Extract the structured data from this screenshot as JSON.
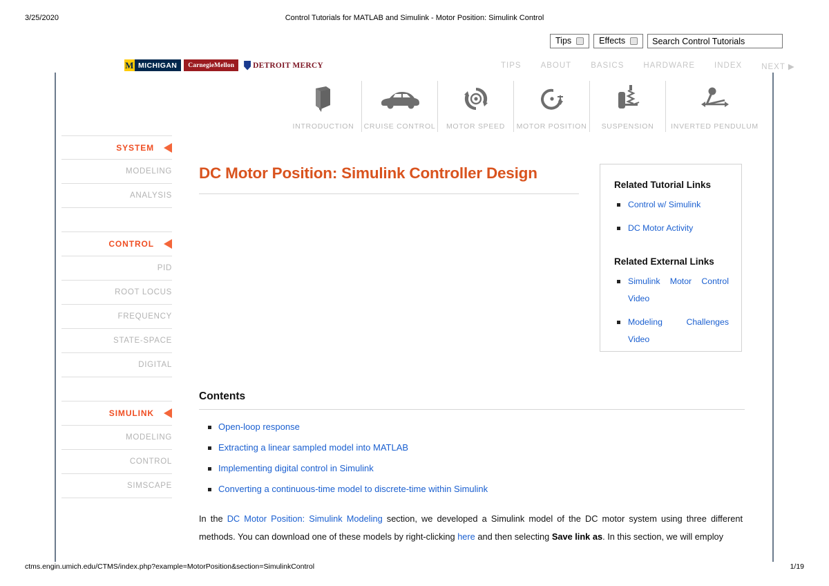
{
  "print_header": {
    "date": "3/25/2020",
    "title": "Control Tutorials for MATLAB and Simulink - Motor Position: Simulink Control"
  },
  "search": {
    "tips_label": "Tips",
    "effects_label": "Effects",
    "placeholder": "Search Control Tutorials",
    "value": "Search Control Tutorials"
  },
  "logos": [
    {
      "name": "university-of-michigan",
      "mark": "M",
      "text": "MICHIGAN"
    },
    {
      "name": "carnegie-mellon",
      "text": "CarnegieMellon"
    },
    {
      "name": "detroit-mercy",
      "text": "DETROIT MERCY"
    }
  ],
  "topnav": [
    {
      "label": "TIPS"
    },
    {
      "label": "ABOUT"
    },
    {
      "label": "BASICS"
    },
    {
      "label": "HARDWARE"
    },
    {
      "label": "INDEX"
    },
    {
      "label": "NEXT ▶"
    }
  ],
  "iconnav": [
    {
      "label": "INTRODUCTION",
      "icon": "book-icon"
    },
    {
      "label": "CRUISE CONTROL",
      "icon": "car-icon"
    },
    {
      "label": "MOTOR SPEED",
      "icon": "rotation-speed-icon"
    },
    {
      "label": "MOTOR POSITION",
      "icon": "rotation-position-icon"
    },
    {
      "label": "SUSPENSION",
      "icon": "suspension-strut-icon"
    },
    {
      "label": "INVERTED PENDULUM",
      "icon": "inverted-pendulum-icon"
    }
  ],
  "sidebar": {
    "items": [
      {
        "label": "SYSTEM",
        "type": "head"
      },
      {
        "label": "MODELING",
        "type": "sub"
      },
      {
        "label": "ANALYSIS",
        "type": "sub"
      },
      {
        "label": "",
        "type": "spacer"
      },
      {
        "label": "CONTROL",
        "type": "head"
      },
      {
        "label": "PID",
        "type": "sub"
      },
      {
        "label": "ROOT LOCUS",
        "type": "sub"
      },
      {
        "label": "FREQUENCY",
        "type": "sub"
      },
      {
        "label": "STATE-SPACE",
        "type": "sub"
      },
      {
        "label": "DIGITAL",
        "type": "sub"
      },
      {
        "label": "",
        "type": "spacer"
      },
      {
        "label": "SIMULINK",
        "type": "head"
      },
      {
        "label": "MODELING",
        "type": "sub"
      },
      {
        "label": "CONTROL",
        "type": "sub"
      },
      {
        "label": "SIMSCAPE",
        "type": "sub"
      }
    ]
  },
  "main": {
    "title": "DC Motor Position: Simulink Controller Design",
    "contents_heading": "Contents",
    "contents": [
      {
        "label": "Open-loop response"
      },
      {
        "label": "Extracting a linear sampled model into MATLAB"
      },
      {
        "label": "Implementing digital control in Simulink"
      },
      {
        "label": "Converting a continuous-time model to discrete-time within Simulink"
      }
    ],
    "paragraph": {
      "t1": "In the ",
      "link1": "DC Motor Position: Simulink Modeling",
      "t2": " section, we developed a Simulink model of the DC motor system using three different methods. You can download one of these models by right-clicking ",
      "link2": "here",
      "t3": " and then selecting ",
      "bold1": "Save link as",
      "t4": ". In this section, we will employ"
    }
  },
  "related": {
    "tutorial_heading": "Related Tutorial Links",
    "tutorial_links": [
      {
        "label": "Control w/ Simulink"
      },
      {
        "label": "DC Motor Activity"
      }
    ],
    "external_heading": "Related External Links",
    "external_links": [
      {
        "label": "Simulink Motor Control Video"
      },
      {
        "label": "Modeling Challenges Video"
      }
    ]
  },
  "footer": {
    "url": "ctms.engin.umich.edu/CTMS/index.php?example=MotorPosition&section=SimulinkControl",
    "page": "1/19"
  },
  "colors": {
    "accent_orange": "#d9531e",
    "sidebar_head": "#ef4e23",
    "link_blue": "#1a5fd0",
    "icon_gray": "#6e6e6e",
    "label_gray": "#b9b9b9"
  }
}
